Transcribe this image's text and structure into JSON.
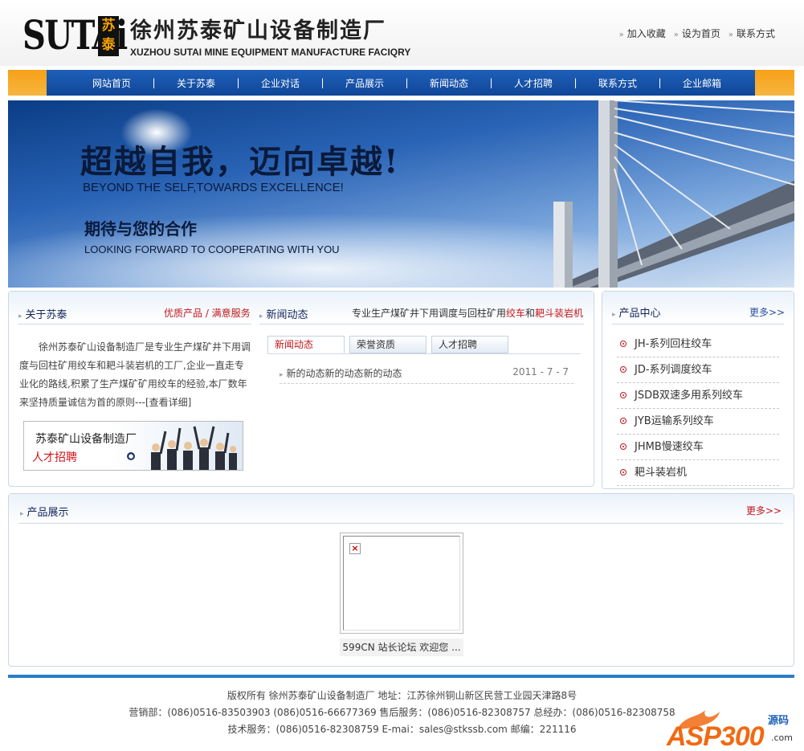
{
  "header": {
    "logo_text": "SUTAi",
    "logo_box": "苏泰",
    "company_cn": "徐州苏泰矿山设备制造厂",
    "company_en": "XUZHOU SUTAI MINE EQUIPMENT MANUFACTURE FACIQRY",
    "links": [
      "加入收藏",
      "设为首页",
      "联系方式"
    ]
  },
  "nav": {
    "items": [
      "网站首页",
      "关于苏泰",
      "企业对话",
      "产品展示",
      "新闻动态",
      "人才招聘",
      "联系方式",
      "企业邮箱"
    ],
    "separator": "|"
  },
  "banner": {
    "slogan_cn": "超越自我，迈向卓越!",
    "slogan_en": "BEYOND THE SELF,TOWARDS EXCELLENCE!",
    "slogan2_cn": "期待与您的合作",
    "slogan2_en": "LOOKING FORWARD TO COOPERATING WITH YOU"
  },
  "about": {
    "title": "关于苏泰",
    "tag": "优质产品 / 满意服务",
    "text": "徐州苏泰矿山设备制造厂是专业生产煤矿井下用调度与回柱矿用绞车和耙斗装岩机的工厂,企业一直走专业化的路线,积累了生产煤矿矿用绞车的经验,本厂数年来坚持质量诚信为首的原则---[查看详细]",
    "hire_top": "苏泰矿山设备制造厂",
    "hire_bottom": "人才招聘",
    "hire_go": "●"
  },
  "news": {
    "title": "新闻动态",
    "tag_prefix": "专业生产煤矿井下用调度与回柱矿用",
    "tag_red1": "绞车",
    "tag_mid": "和",
    "tag_red2": "耙斗装岩机",
    "tabs": [
      "新闻动态",
      "荣誉资质",
      "人才招聘"
    ],
    "items": [
      {
        "title": "新的动态新的动态新的动态",
        "date": "2011 - 7 - 7"
      }
    ]
  },
  "products": {
    "title": "产品中心",
    "more": "更多>>",
    "items": [
      "JH-系列回柱绞车",
      "JD-系列调度绞车",
      "JSDB双速多用系列绞车",
      "JYB运输系列绞车",
      "JHMB慢速绞车",
      "耙斗装岩机"
    ]
  },
  "showcase": {
    "title": "产品展示",
    "more": "更多>>",
    "caption": "599CN 站长论坛 欢迎您 ...",
    "broken_icon": "×"
  },
  "footer": {
    "line1": "版权所有 徐州苏泰矿山设备制造厂 地址：江苏徐州铜山新区民营工业园天津路8号",
    "line2": "营销部：(086)0516-83503903 (086)0516-66677369 售后服务：(086)0516-82308757 总经办：(086)0516-82308758",
    "line3": "技术服务：(086)0516-82308759 E-mai：sales@stkssb.com 邮编：221116"
  },
  "watermark": {
    "text": "ASP300",
    "sub": "源码",
    "com": ".com"
  }
}
